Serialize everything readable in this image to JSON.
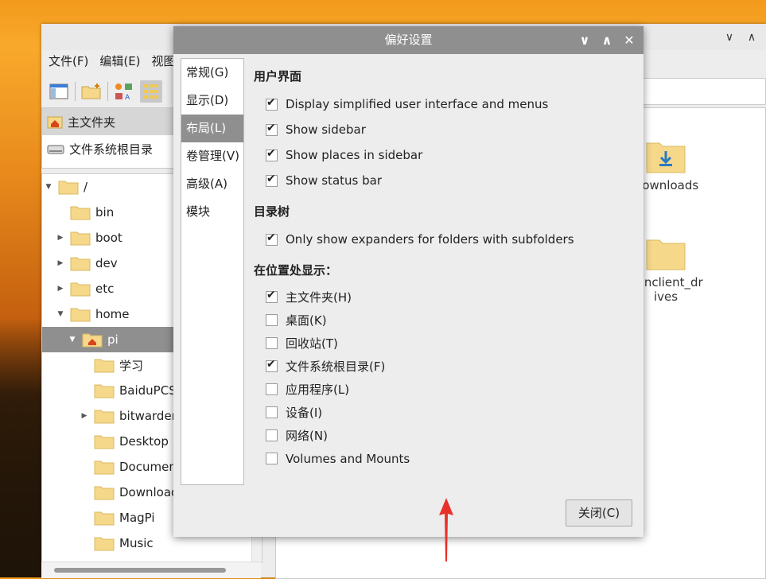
{
  "file_manager": {
    "menu": [
      "文件(F)",
      "编辑(E)",
      "视图"
    ],
    "window_controls": [
      "chevron-down",
      "chevron-up",
      "close"
    ],
    "places": [
      {
        "label": "主文件夹",
        "icon": "home-icon",
        "selected": true
      },
      {
        "label": "文件系统根目录",
        "icon": "drive-icon",
        "selected": false
      }
    ],
    "tree": [
      {
        "label": "/",
        "indent": 0,
        "expander": "open"
      },
      {
        "label": "bin",
        "indent": 1,
        "expander": ""
      },
      {
        "label": "boot",
        "indent": 1,
        "expander": "closed"
      },
      {
        "label": "dev",
        "indent": 1,
        "expander": "closed"
      },
      {
        "label": "etc",
        "indent": 1,
        "expander": "closed"
      },
      {
        "label": "home",
        "indent": 1,
        "expander": "open"
      },
      {
        "label": "pi",
        "indent": 2,
        "expander": "open",
        "selected": true,
        "home": true
      },
      {
        "label": "学习",
        "indent": 3,
        "expander": ""
      },
      {
        "label": "BaiduPCS-",
        "indent": 3,
        "expander": ""
      },
      {
        "label": "bitwarden",
        "indent": 3,
        "expander": "closed"
      },
      {
        "label": "Desktop",
        "indent": 3,
        "expander": ""
      },
      {
        "label": "Document",
        "indent": 3,
        "expander": ""
      },
      {
        "label": "Download",
        "indent": 3,
        "expander": ""
      },
      {
        "label": "MagPi",
        "indent": 3,
        "expander": ""
      },
      {
        "label": "Music",
        "indent": 3,
        "expander": ""
      }
    ],
    "icons": [
      {
        "label": "Downloads",
        "partial": "s"
      },
      {
        "label": "thinclient_drives",
        "partial": "s"
      }
    ]
  },
  "dialog": {
    "title": "偏好设置",
    "tabs": [
      {
        "label": "常规(G)",
        "selected": false
      },
      {
        "label": "显示(D)",
        "selected": false
      },
      {
        "label": "布局(L)",
        "selected": true
      },
      {
        "label": "卷管理(V)",
        "selected": false
      },
      {
        "label": "高级(A)",
        "selected": false
      },
      {
        "label": "模块",
        "selected": false
      }
    ],
    "sections": {
      "ui": {
        "title": "用户界面",
        "options": [
          {
            "label": "Display simplified user interface and menus",
            "checked": true
          },
          {
            "label": "Show sidebar",
            "checked": true
          },
          {
            "label": "Show places in sidebar",
            "checked": true
          },
          {
            "label": "Show status bar",
            "checked": true
          }
        ]
      },
      "tree": {
        "title": "目录树",
        "options": [
          {
            "label": "Only show expanders for folders with subfolders",
            "checked": true
          }
        ]
      },
      "places": {
        "title": "在位置处显示：",
        "options": [
          {
            "label": "主文件夹(H)",
            "checked": true
          },
          {
            "label": "桌面(K)",
            "checked": false
          },
          {
            "label": "回收站(T)",
            "checked": false
          },
          {
            "label": "文件系统根目录(F)",
            "checked": true
          },
          {
            "label": "应用程序(L)",
            "checked": false
          },
          {
            "label": "设备(I)",
            "checked": false
          },
          {
            "label": "网络(N)",
            "checked": false
          },
          {
            "label": "Volumes and Mounts",
            "checked": false
          }
        ]
      }
    },
    "close_label": "关闭(C)",
    "annotation_color": "#e8312a"
  }
}
